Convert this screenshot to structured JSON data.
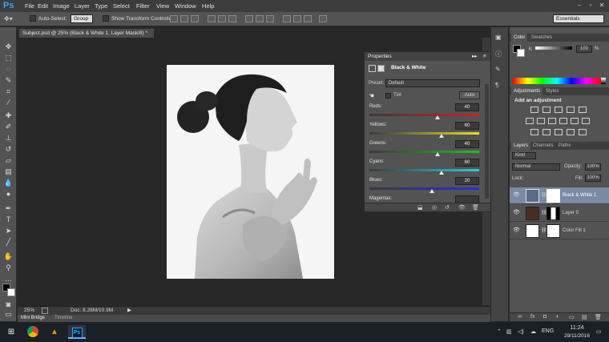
{
  "app": {
    "logo": "Ps"
  },
  "menu": [
    "File",
    "Edit",
    "Image",
    "Layer",
    "Type",
    "Select",
    "Filter",
    "View",
    "Window",
    "Help"
  ],
  "window_controls": [
    "–",
    "▫",
    "✕"
  ],
  "options_bar": {
    "auto_select_label": "Auto-Select:",
    "auto_select_value": "Group",
    "transform_label": "Show Transform Controls",
    "workspace": "Essentials"
  },
  "document": {
    "tab_title": "Subject.psd @ 25% (Black & White 1, Layer Mask/8) *",
    "zoom": "25%",
    "doc_size": "Doc: 8.28M/10.9M"
  },
  "bottom_tabs": [
    "Mini Bridge",
    "Timeline"
  ],
  "properties": {
    "panel_title": "Properties",
    "adjustment_name": "Black & White",
    "preset_label": "Preset:",
    "preset_value": "Default",
    "tint_label": "Tint",
    "auto_label": "Auto",
    "sliders": [
      {
        "label": "Reds:",
        "value": "40",
        "pos": 0.62,
        "gradient": "linear-gradient(90deg,#3a3a3a,#d02020)"
      },
      {
        "label": "Yellows:",
        "value": "60",
        "pos": 0.66,
        "gradient": "linear-gradient(90deg,#3a3a3a,#e8e020)"
      },
      {
        "label": "Greens:",
        "value": "40",
        "pos": 0.62,
        "gradient": "linear-gradient(90deg,#3a3a3a,#20c020)"
      },
      {
        "label": "Cyans:",
        "value": "60",
        "pos": 0.66,
        "gradient": "linear-gradient(90deg,#3a3a3a,#20d0e0)"
      },
      {
        "label": "Blues:",
        "value": "20",
        "pos": 0.57,
        "gradient": "linear-gradient(90deg,#3a3a3a,#2030e0)"
      },
      {
        "label": "Magentas:",
        "value": "",
        "pos": 0.6,
        "gradient": "linear-gradient(90deg,#3a3a3a,#d020d0)"
      }
    ]
  },
  "color_panel": {
    "tabs": [
      "Color",
      "Swatches"
    ],
    "channel": "K",
    "value": "100",
    "unit": "%"
  },
  "adjustments_panel": {
    "tabs": [
      "Adjustments",
      "Styles"
    ],
    "heading": "Add an adjustment"
  },
  "layers_panel": {
    "tabs": [
      "Layers",
      "Channels",
      "Paths"
    ],
    "kind": "Kind",
    "blend_mode": "Normal",
    "opacity_label": "Opacity:",
    "opacity_value": "100%",
    "lock_label": "Lock:",
    "fill_label": "Fill:",
    "fill_value": "100%",
    "layers": [
      {
        "name": "Black & White 1",
        "selected": true
      },
      {
        "name": "Layer 0",
        "selected": false
      },
      {
        "name": "Color Fill 1",
        "selected": false
      }
    ],
    "footer_icons": [
      "∞",
      "fx",
      "◘",
      "◐",
      "▭",
      "▤",
      "🗑"
    ]
  },
  "taskbar": {
    "language": "ENG",
    "time": "11:24",
    "date": "29/11/2016"
  }
}
